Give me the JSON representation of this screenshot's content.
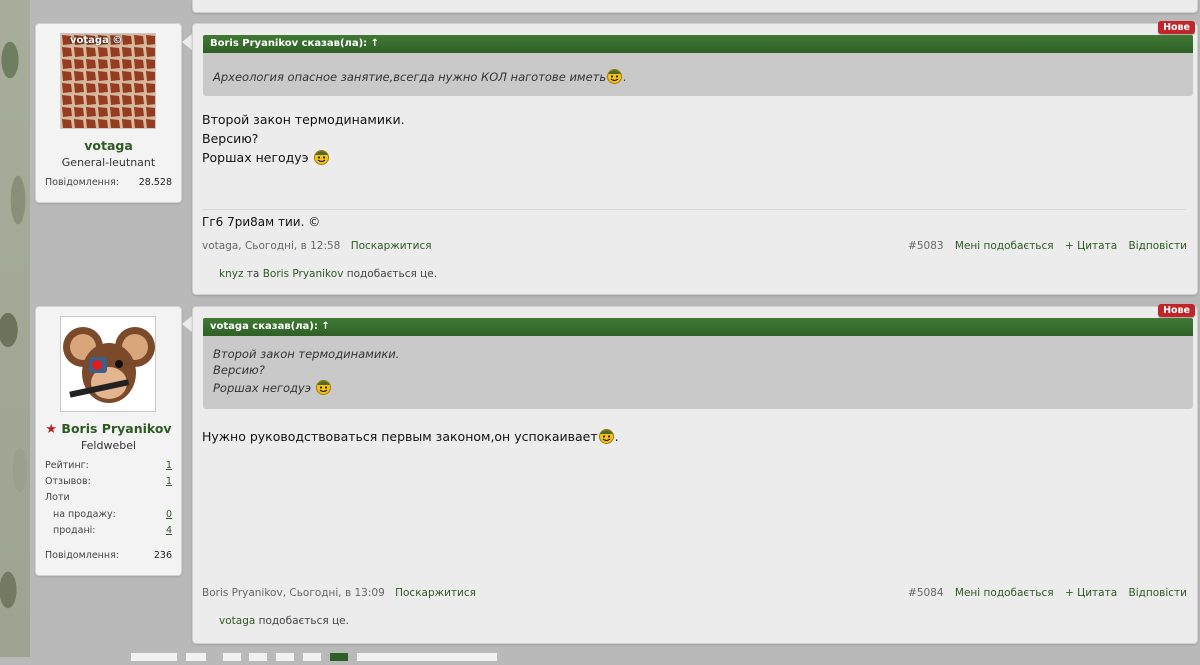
{
  "posts": [
    {
      "user": {
        "name": "votaga",
        "title": "General-leutnant",
        "avatar_overlay": "votaga ©",
        "stats": [
          {
            "label": "Повідомлення:",
            "value": "28.528"
          }
        ]
      },
      "badge": "Нове",
      "quote": {
        "author": "Boris Pryanikov сказав(ла): ↑",
        "lines": [
          "Археология опасное занятие,всегда нужно КОЛ наготове иметь",
          "."
        ]
      },
      "message": [
        "Второй закон термодинамики.",
        "Версию?",
        "Роршах негодуэ"
      ],
      "signature": "Гг6 7ри8ам тии. ©",
      "meta": {
        "author": "votaga",
        "time": ", Сьогодні, в 12:58",
        "report": "Поскаржитися"
      },
      "actions": {
        "number": "#5083",
        "like": "Мені подобається",
        "quote": "+ Цитата",
        "reply": "Відповісти"
      },
      "likes": {
        "user1": "knyz",
        "sep": " та ",
        "user2": "Boris Pryanikov",
        "suffix": " подобається це."
      }
    },
    {
      "user": {
        "name": "Boris Pryanikov",
        "title": "Feldwebel",
        "stats": [
          {
            "label": "Рейтинг:",
            "value": "1"
          },
          {
            "label": "Отзывов:",
            "value": "1"
          },
          {
            "label": "Лоти",
            "value": ""
          },
          {
            "label": "на продажу:",
            "value": "0"
          },
          {
            "label": "продані:",
            "value": "4"
          },
          {
            "label": "Повідомлення:",
            "value": "236"
          }
        ]
      },
      "badge": "Нове",
      "quote": {
        "author": "votaga сказав(ла): ↑",
        "lines": [
          "Второй закон термодинамики.",
          "Версию?",
          "Роршах негодуэ"
        ]
      },
      "message": [
        "Нужно руководствоваться первым законом,он успокаивает",
        "."
      ],
      "meta": {
        "author": "Boris Pryanikov",
        "time": ", Сьогодні, в 13:09",
        "report": "Поскаржитися"
      },
      "actions": {
        "number": "#5084",
        "like": "Мені подобається",
        "quote": "+ Цитата",
        "reply": "Відповісти"
      },
      "likes": {
        "user1": "votaga",
        "suffix": " подобається це."
      }
    }
  ],
  "icons": {
    "smiley": "soldier-smiley-icon",
    "star": "red-star-icon"
  },
  "colors": {
    "accent": "#2d5a22",
    "badge": "#c0252a",
    "quote_header": "#3f7a34"
  }
}
